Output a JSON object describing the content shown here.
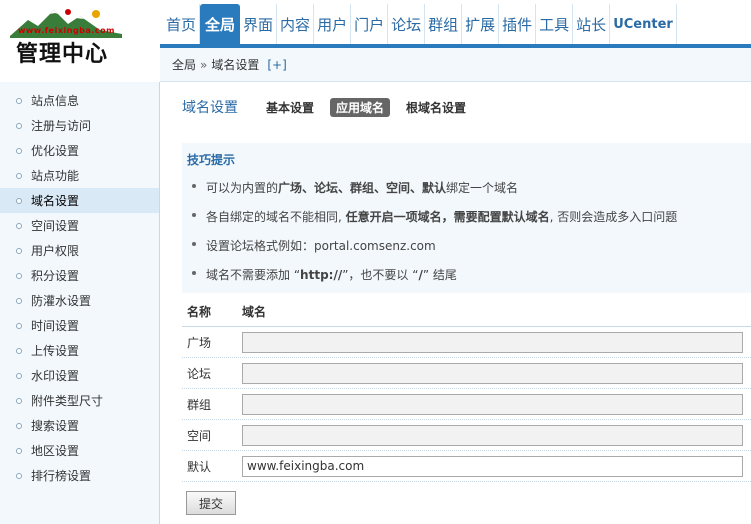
{
  "logo": {
    "site_text": "www.feixingba.com",
    "title": "管理中心",
    "colors": {
      "title": "#111111",
      "site_text": "#cc0000",
      "mountain": "#3a7d3a"
    }
  },
  "topnav": {
    "items": [
      {
        "label": "首页",
        "active": false
      },
      {
        "label": "全局",
        "active": true
      },
      {
        "label": "界面",
        "active": false
      },
      {
        "label": "内容",
        "active": false
      },
      {
        "label": "用户",
        "active": false
      },
      {
        "label": "门户",
        "active": false
      },
      {
        "label": "论坛",
        "active": false
      },
      {
        "label": "群组",
        "active": false
      },
      {
        "label": "扩展",
        "active": false
      },
      {
        "label": "插件",
        "active": false
      },
      {
        "label": "工具",
        "active": false
      },
      {
        "label": "站长",
        "active": false
      },
      {
        "label": "UCenter",
        "active": false
      }
    ],
    "accent": "#2a7bbd"
  },
  "breadcrumb": {
    "root": "全局",
    "separator": "»",
    "current": "域名设置",
    "add": "[+]"
  },
  "sidebar": {
    "items": [
      {
        "label": "站点信息"
      },
      {
        "label": "注册与访问"
      },
      {
        "label": "优化设置"
      },
      {
        "label": "站点功能"
      },
      {
        "label": "域名设置",
        "active": true
      },
      {
        "label": "空间设置"
      },
      {
        "label": "用户权限"
      },
      {
        "label": "积分设置"
      },
      {
        "label": "防灌水设置"
      },
      {
        "label": "时间设置"
      },
      {
        "label": "上传设置"
      },
      {
        "label": "水印设置"
      },
      {
        "label": "附件类型尺寸"
      },
      {
        "label": "搜索设置"
      },
      {
        "label": "地区设置"
      },
      {
        "label": "排行榜设置"
      }
    ]
  },
  "main": {
    "title": "域名设置",
    "tabs": [
      {
        "label": "基本设置",
        "active": false
      },
      {
        "label": "应用域名",
        "active": true
      },
      {
        "label": "根域名设置",
        "active": false
      }
    ],
    "tips": {
      "title": "技巧提示",
      "items": [
        {
          "segments": [
            {
              "text": "可以为内置的",
              "bold": false
            },
            {
              "text": "广场、论坛、群组、空间、默认",
              "bold": true
            },
            {
              "text": "绑定一个域名",
              "bold": false
            }
          ]
        },
        {
          "segments": [
            {
              "text": "各自绑定的域名不能相同, ",
              "bold": false
            },
            {
              "text": "任意开启一项域名，需要配置默认域名",
              "bold": true
            },
            {
              "text": ", 否则会造成多入口问题",
              "bold": false
            }
          ]
        },
        {
          "segments": [
            {
              "text": "设置论坛格式例如：portal.comsenz.com",
              "bold": false
            }
          ]
        },
        {
          "segments": [
            {
              "text": "域名不需要添加 “",
              "bold": false
            },
            {
              "text": "http://",
              "bold": true
            },
            {
              "text": "”，也不要以 “",
              "bold": false
            },
            {
              "text": "/",
              "bold": true
            },
            {
              "text": "” 结尾",
              "bold": false
            }
          ]
        }
      ]
    },
    "form": {
      "header": {
        "name": "名称",
        "domain": "域名"
      },
      "rows": [
        {
          "label": "广场",
          "value": ""
        },
        {
          "label": "论坛",
          "value": ""
        },
        {
          "label": "群组",
          "value": ""
        },
        {
          "label": "空间",
          "value": ""
        },
        {
          "label": "默认",
          "value": "www.feixingba.com"
        }
      ],
      "submit_label": "提交"
    }
  }
}
